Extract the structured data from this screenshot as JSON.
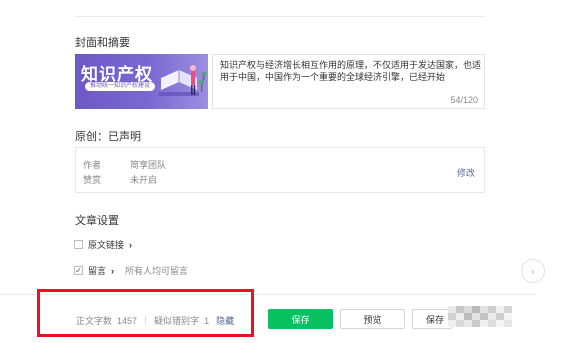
{
  "cover_section": {
    "title": "封面和摘要",
    "cover_image": {
      "title": "知识产权",
      "subtitle": "推动统一知识产权建设"
    },
    "summary": {
      "text": "知识产权与经济增长相互作用的原理，不仅适用于发达国家，也适用于中国，中国作为一个重要的全球经济引擎，已经开始",
      "count": "54/120"
    }
  },
  "original_section": {
    "title": "原创：已声明",
    "author_label": "作者",
    "author_value": "简享团队",
    "reward_label": "赞赏",
    "reward_value": "未开启",
    "edit_label": "修改"
  },
  "settings_section": {
    "title": "文章设置",
    "original_link_label": "原文链接",
    "comment_label": "留言",
    "comment_note": "所有人均可留言",
    "chevron": "›",
    "check": "✓"
  },
  "side_button_icon": "chevron-left-icon",
  "bottom_bar": {
    "word_count_label": "正文字数",
    "word_count_value": "1457",
    "suspected_label": "疑似错别字",
    "suspected_value": "1",
    "hide_label": "隐藏",
    "save_label": "保存",
    "preview_label": "预览",
    "third_label": "保存"
  },
  "colors": {
    "primary_green": "#07c160",
    "link_blue": "#576b95",
    "highlight_red": "#e81224",
    "cover_purple": "#6c59c6"
  }
}
